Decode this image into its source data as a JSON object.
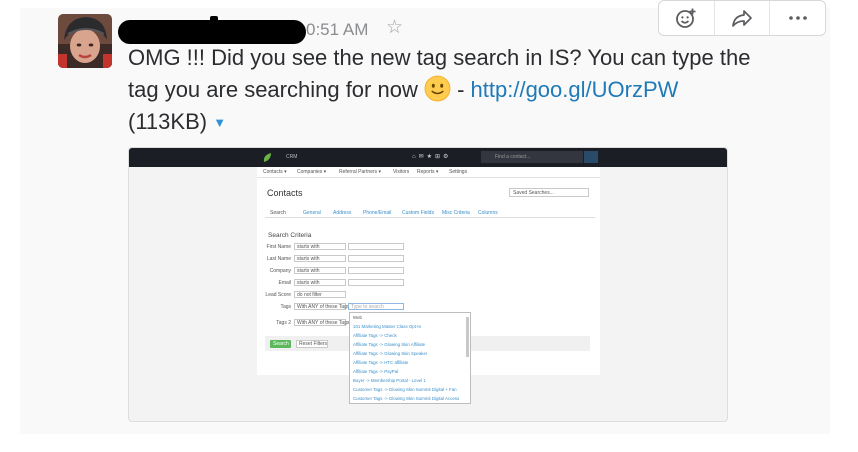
{
  "message": {
    "time": "0:51 AM",
    "text_before_emoji": "OMG !!! Did you see the new tag search in IS? You can type the tag you are searching for now",
    "separator": " - ",
    "link_text": "http://goo.gl/UOrzPW",
    "file_size": "(113KB)"
  },
  "icons": {
    "star": "star-outline-icon",
    "add_reaction": "add-reaction-icon",
    "share": "share-icon",
    "more": "more-actions-icon",
    "emoji": "slightly-smiling-face"
  },
  "colors": {
    "link": "#1f7ab8",
    "caret": "#2f92d9",
    "timestamp": "#8b8c8f"
  },
  "screenshot": {
    "brand": "CRM",
    "search_placeholder": "Find a contact...",
    "nav": [
      "Contacts ▾",
      "Companies ▾",
      "Referral Partners ▾",
      "Visitors",
      "Reports ▾",
      "Settings"
    ],
    "page_title": "Contacts",
    "saved_search": "Saved Searches...",
    "tabs": [
      "Search",
      "General",
      "Address",
      "Phone/Email",
      "Custom Fields",
      "Misc Criteria",
      "Columns"
    ],
    "section_title": "Search Criteria",
    "criteria": [
      {
        "label": "First Name",
        "op": "starts with"
      },
      {
        "label": "Last Name",
        "op": "starts with"
      },
      {
        "label": "Company",
        "op": "starts with"
      },
      {
        "label": "Email",
        "op": "starts with"
      },
      {
        "label": "Lead Score",
        "op": "do not filter"
      },
      {
        "label": "Tags",
        "op": "With ANY of these Tags"
      },
      {
        "label": "Tags 2",
        "op": "With ANY of these Tags"
      }
    ],
    "tag_placeholder": "Type to search",
    "tag_options": [
      "Web",
      "101 Marketing Master Class Opt-In",
      "Affiliate Tags -> Check",
      "Affiliate Tags -> Glowing Skin Affiliate",
      "Affiliate Tags -> Glowing Skin Speaker",
      "Affiliate Tags -> HTC affiliate",
      "Affiliate Tags -> PayPal",
      "Buyer -> Membership Portal - Level 1",
      "Customer Tags -> Glowing Skin Summit Digital + Fan",
      "Customer Tags -> Glowing Skin Summit Digital Access"
    ],
    "search_button": "Search",
    "reset_button": "Reset Filters"
  }
}
